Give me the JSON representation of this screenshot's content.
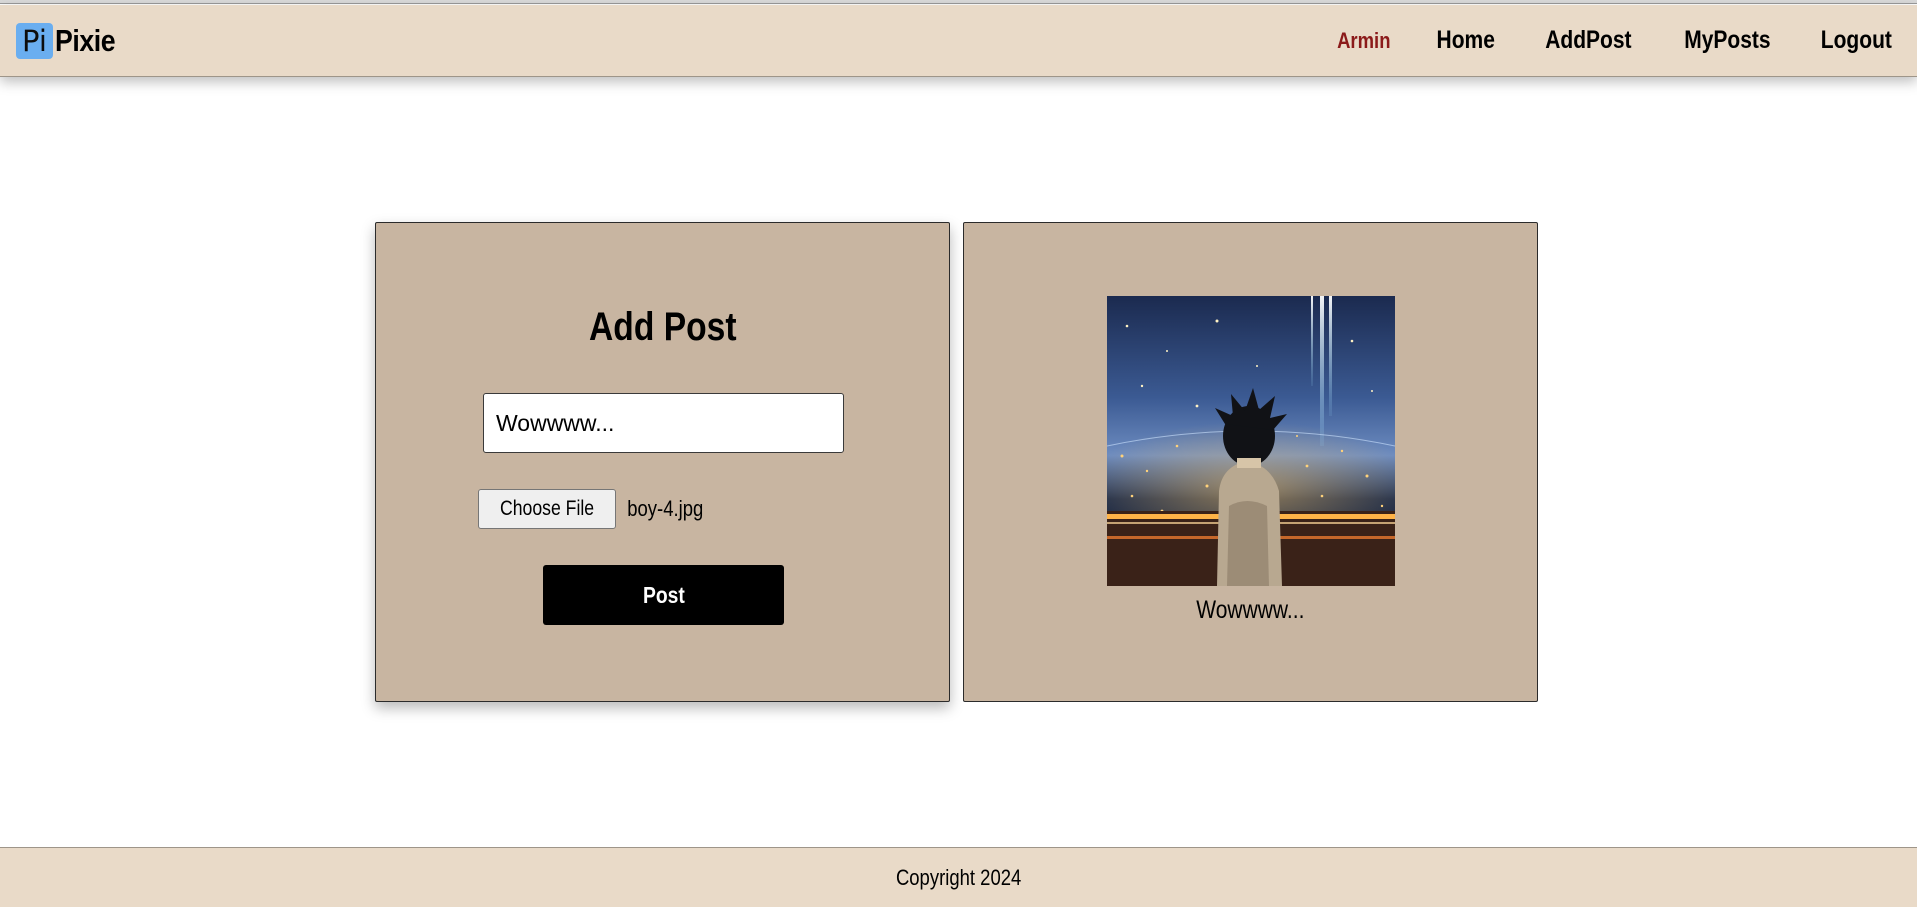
{
  "header": {
    "logo_mark": "Pi",
    "brand": "Pixie",
    "nav": {
      "user": "Armin",
      "home": "Home",
      "add_post": "AddPost",
      "my_posts": "MyPosts",
      "logout": "Logout"
    }
  },
  "form": {
    "title": "Add Post",
    "caption_value": "Wowwww...",
    "file_button": "Choose File",
    "file_name": "boy-4.jpg",
    "submit": "Post"
  },
  "preview": {
    "image_icon": "anime-boy-night-city-image",
    "caption": "Wowwww..."
  },
  "footer": {
    "copyright": "Copyright 2024"
  },
  "colors": {
    "header_bg": "#e9dac8",
    "card_bg": "#c8b5a1",
    "logo_bg": "#6aaef0",
    "user_link": "#8b1a1a",
    "button_bg": "#000000"
  }
}
